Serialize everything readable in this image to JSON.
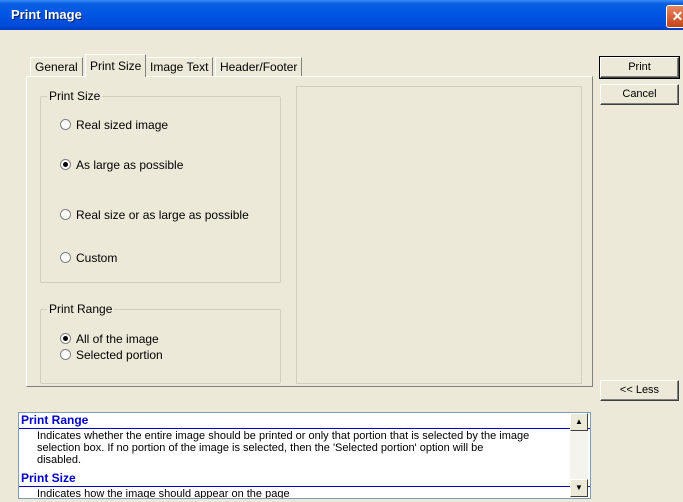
{
  "window": {
    "title": "Print Image",
    "close_glyph": "✕"
  },
  "buttons": {
    "print": "Print",
    "cancel": "Cancel",
    "less": "<< Less"
  },
  "tabs": [
    "General",
    "Print Size",
    "Image Text",
    "Header/Footer"
  ],
  "active_tab": "Print Size",
  "print_size": {
    "title": "Print Size",
    "options": [
      {
        "label": "Real sized image",
        "selected": false
      },
      {
        "label": "As large as possible",
        "selected": true
      },
      {
        "label": "Real size or as large as possible",
        "selected": false
      },
      {
        "label": "Custom",
        "selected": false
      }
    ]
  },
  "print_range": {
    "title": "Print Range",
    "options": [
      {
        "label": "All of the image",
        "selected": true
      },
      {
        "label": "Selected portion",
        "selected": false
      }
    ]
  },
  "help": {
    "sections": [
      {
        "title": "Print Range",
        "lines": [
          "Indicates whether the entire image should be printed or only that portion that is selected by the image",
          "selection box.  If no portion of the image is selected, then the 'Selected portion' option will be",
          "disabled."
        ]
      },
      {
        "title": "Print Size",
        "lines": [
          "Indicates how the image should appear on the page"
        ]
      }
    ]
  }
}
